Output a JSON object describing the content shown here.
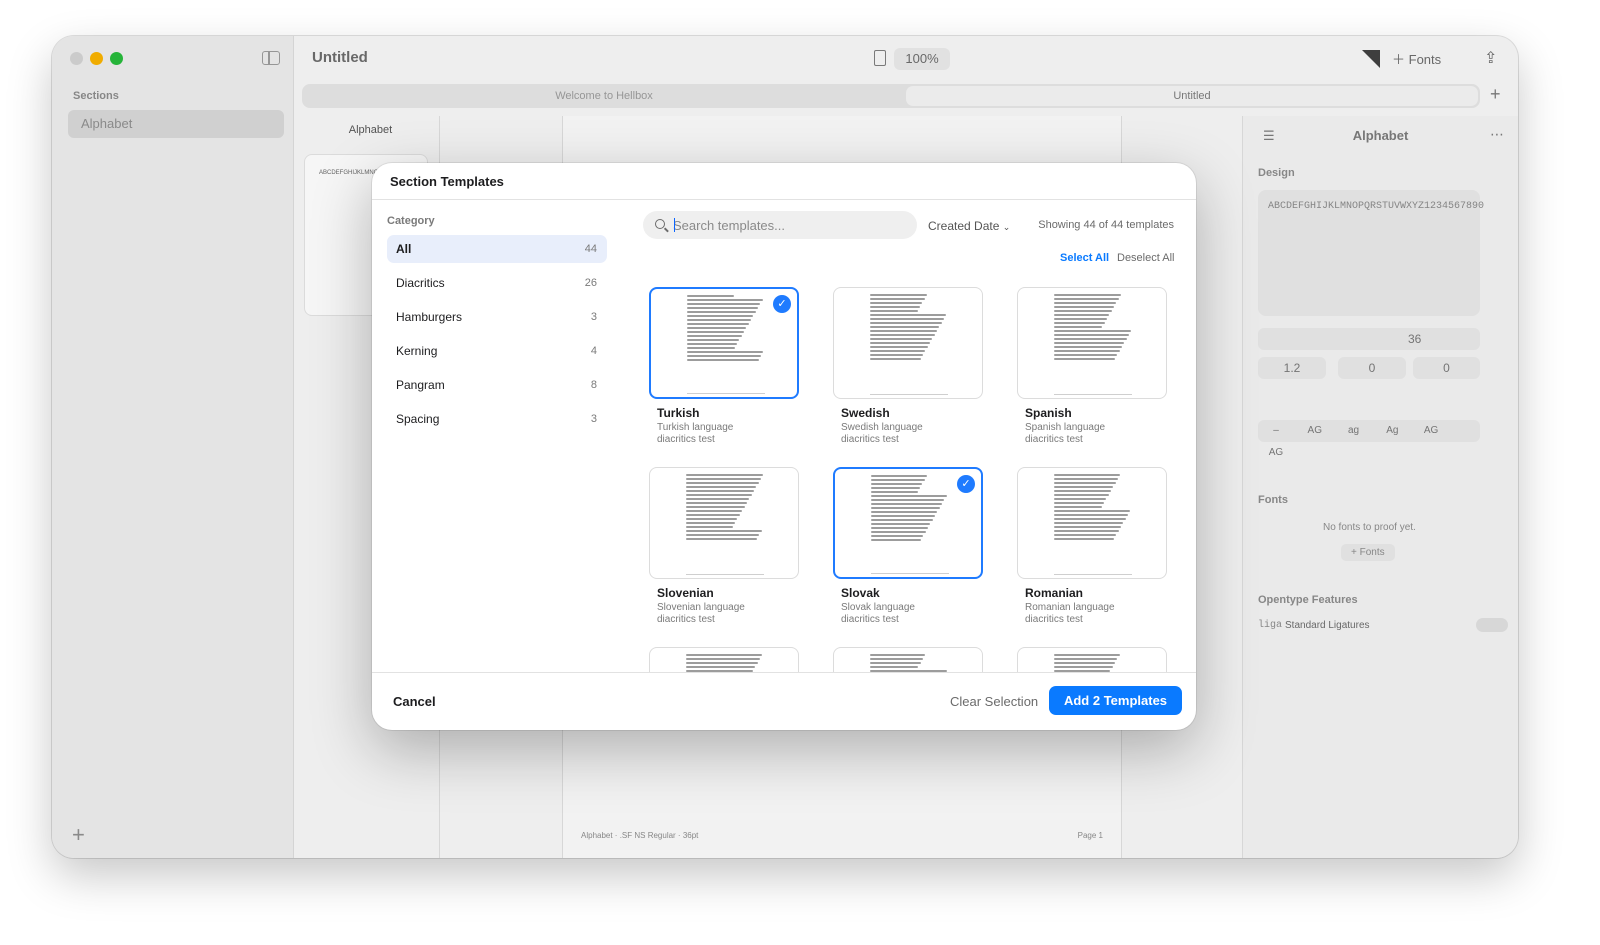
{
  "window": {
    "title": "Untitled",
    "zoom": "100%",
    "fonts_button": "Fonts"
  },
  "sidebar": {
    "label": "Sections",
    "items": [
      {
        "label": "Alphabet"
      }
    ],
    "add": "+"
  },
  "tabs": [
    {
      "label": "Welcome to Hellbox"
    },
    {
      "label": "Untitled"
    }
  ],
  "middle": {
    "title": "Alphabet",
    "thumb_text": "ABCDEFGHIJKLMNOPQRSTUVWXYZ1234567890",
    "page_num": "1"
  },
  "canvas": {
    "footer_left": "Alphabet · .SF NS Regular · 36pt",
    "footer_right": "Page 1"
  },
  "inspector": {
    "title": "Alphabet",
    "design_label": "Design",
    "design_text": "ABCDEFGHIJKLMNOPQRSTUVWXYZ1234567890",
    "font_size": "36",
    "line_height": "1.2",
    "tracking": "0",
    "paragraph": "0",
    "case_options": [
      "–",
      "AG",
      "ag",
      "Ag",
      "AG",
      "AG"
    ],
    "fonts_label": "Fonts",
    "no_fonts": "No fonts to proof yet.",
    "add_fonts": "+ Fonts",
    "opentype_label": "Opentype Features",
    "liga_tag": "liga",
    "liga_name": "Standard Ligatures"
  },
  "modal": {
    "title": "Section Templates",
    "category_label": "Category",
    "categories": [
      {
        "name": "All",
        "count": "44",
        "active": true
      },
      {
        "name": "Diacritics",
        "count": "26",
        "active": false
      },
      {
        "name": "Hamburgers",
        "count": "3",
        "active": false
      },
      {
        "name": "Kerning",
        "count": "4",
        "active": false
      },
      {
        "name": "Pangram",
        "count": "8",
        "active": false
      },
      {
        "name": "Spacing",
        "count": "3",
        "active": false
      }
    ],
    "search_placeholder": "Search templates...",
    "sort_label": "Created Date",
    "showing": "Showing 44 of 44 templates",
    "select_all": "Select All",
    "deselect_all": "Deselect All",
    "templates": [
      {
        "name": "Turkish",
        "desc": "Turkish language diacritics test",
        "selected": true
      },
      {
        "name": "Swedish",
        "desc": "Swedish language diacritics test",
        "selected": false
      },
      {
        "name": "Spanish",
        "desc": "Spanish language diacritics test",
        "selected": false
      },
      {
        "name": "Slovenian",
        "desc": "Slovenian language diacritics test",
        "selected": false
      },
      {
        "name": "Slovak",
        "desc": "Slovak language diacritics test",
        "selected": true
      },
      {
        "name": "Romanian",
        "desc": "Romanian language diacritics test",
        "selected": false
      }
    ],
    "cancel": "Cancel",
    "clear_selection": "Clear Selection",
    "add_button": "Add 2 Templates"
  },
  "colors": {
    "accent": "#0a7aff",
    "selected_border": "#1f7bff",
    "category_active_bg": "#e8eefb"
  }
}
